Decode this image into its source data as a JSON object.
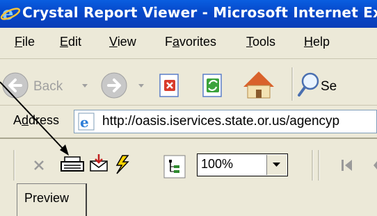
{
  "window": {
    "title": "Crystal Report Viewer - Microsoft Internet Ex"
  },
  "menu": {
    "items": [
      {
        "first": "F",
        "rest": "ile"
      },
      {
        "first": "E",
        "rest": "dit"
      },
      {
        "first": "V",
        "rest": "iew"
      },
      {
        "pre": "F",
        "first": "a",
        "rest": "vorites"
      },
      {
        "first": "T",
        "rest": "ools"
      },
      {
        "first": "H",
        "rest": "elp"
      }
    ]
  },
  "toolbar": {
    "back_label": "Back",
    "search_label": "Se"
  },
  "address": {
    "label_pre": "A",
    "label_ul": "d",
    "label_rest": "dress",
    "url": "http://oasis.iservices.state.or.us/agencyp"
  },
  "crystal": {
    "zoom_value": "100%",
    "tab_label": "Preview"
  },
  "colors": {
    "titlebar": "#0a4fd6",
    "chrome": "#ece9d8"
  }
}
